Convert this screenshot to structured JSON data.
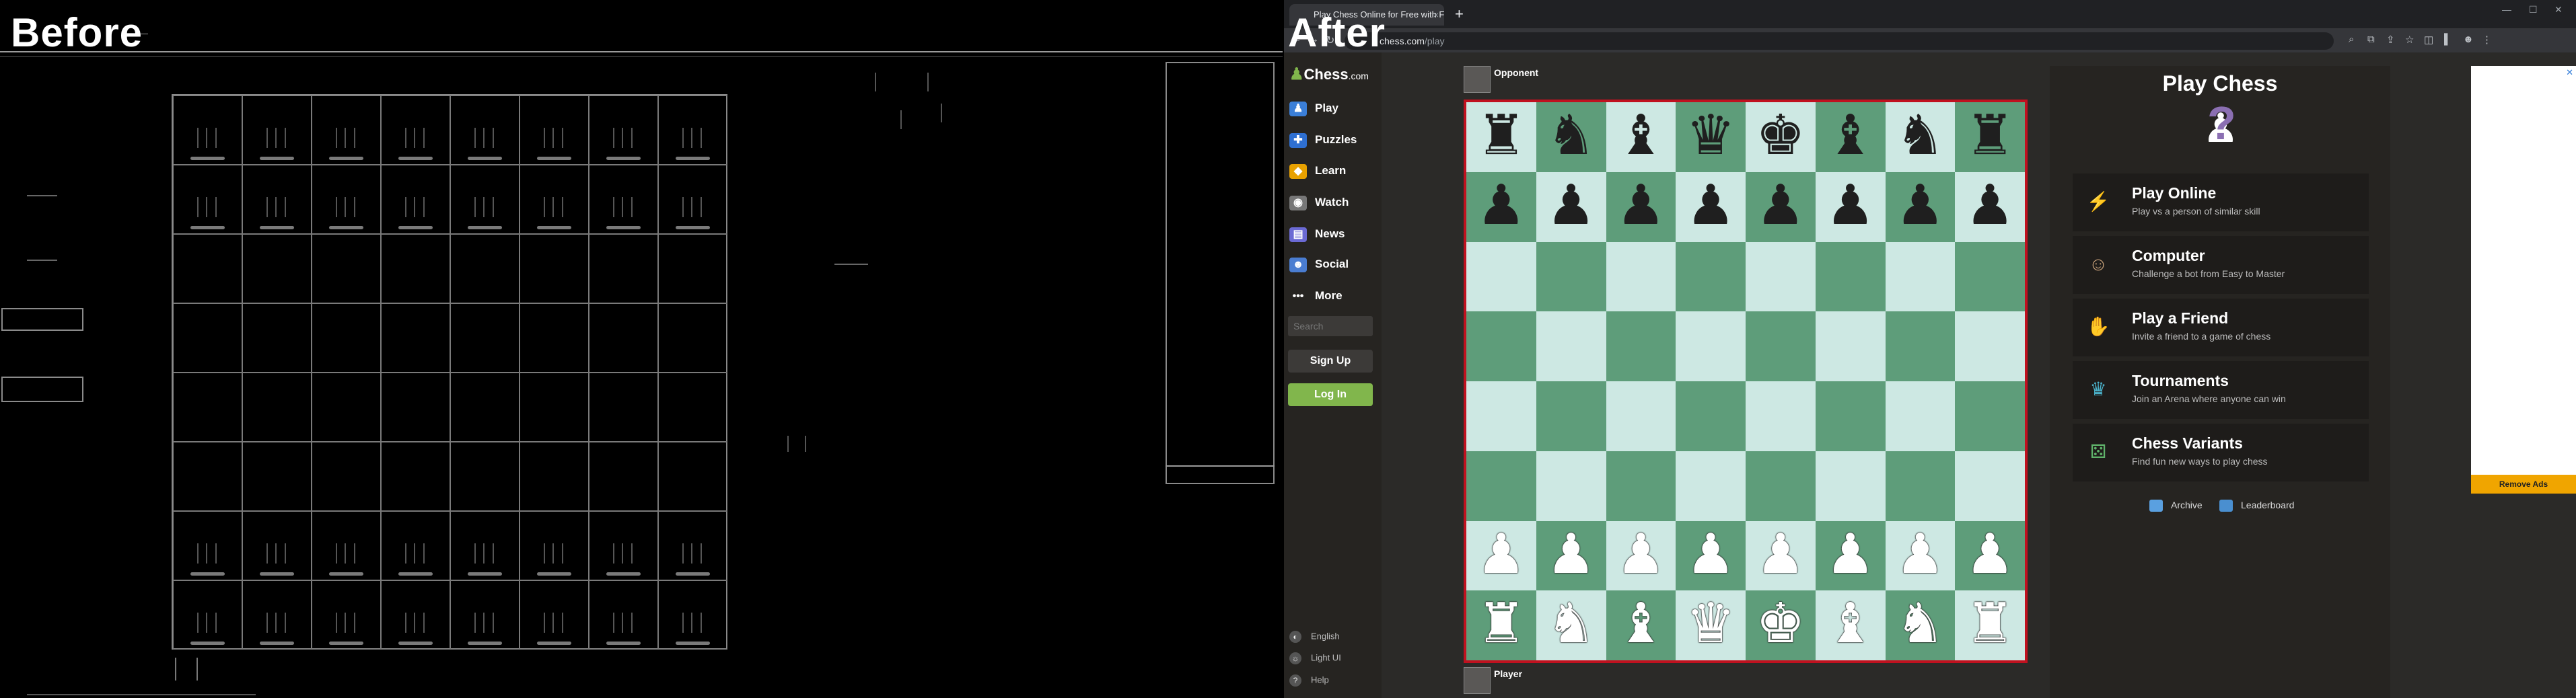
{
  "labels": {
    "before": "Before",
    "after": "After"
  },
  "browser": {
    "tab_title": "Play Chess Online for Free with Friends",
    "tab_close": "×",
    "new_tab": "+",
    "url_host": "chess.com",
    "url_path": "/play",
    "win_min": "—",
    "win_max": "☐",
    "win_close": "✕"
  },
  "sidebar": {
    "logo_text": "Chess",
    "logo_suffix": ".com",
    "items": [
      {
        "label": "Play",
        "icon": "play-icon",
        "color": "#3b7fd8",
        "glyph": "♟"
      },
      {
        "label": "Puzzles",
        "icon": "puzzle-icon",
        "color": "#2e6fd1",
        "glyph": "✚"
      },
      {
        "label": "Learn",
        "icon": "learn-icon",
        "color": "#e8a100",
        "glyph": "◆"
      },
      {
        "label": "Watch",
        "icon": "watch-icon",
        "color": "#777777",
        "glyph": "◉"
      },
      {
        "label": "News",
        "icon": "news-icon",
        "color": "#6b6ad4",
        "glyph": "▤"
      },
      {
        "label": "Social",
        "icon": "social-icon",
        "color": "#4a7dd1",
        "glyph": "☻"
      },
      {
        "label": "More",
        "icon": "more-icon",
        "color": "#262421",
        "glyph": "•••"
      }
    ],
    "search_placeholder": "Search",
    "signup": "Sign Up",
    "login": "Log In",
    "footer": [
      {
        "label": "English",
        "glyph": "◐"
      },
      {
        "label": "Light UI",
        "glyph": "☼"
      },
      {
        "label": "Help",
        "glyph": "?"
      }
    ]
  },
  "board": {
    "opponent": "Opponent",
    "player": "Player",
    "rows": [
      [
        "r",
        "n",
        "b",
        "q",
        "k",
        "b",
        "n",
        "r"
      ],
      [
        "p",
        "p",
        "p",
        "p",
        "p",
        "p",
        "p",
        "p"
      ],
      [
        "",
        "",
        "",
        "",
        "",
        "",
        "",
        ""
      ],
      [
        "",
        "",
        "",
        "",
        "",
        "",
        "",
        ""
      ],
      [
        "",
        "",
        "",
        "",
        "",
        "",
        "",
        ""
      ],
      [
        "",
        "",
        "",
        "",
        "",
        "",
        "",
        ""
      ],
      [
        "P",
        "P",
        "P",
        "P",
        "P",
        "P",
        "P",
        "P"
      ],
      [
        "R",
        "N",
        "B",
        "Q",
        "K",
        "B",
        "N",
        "R"
      ]
    ]
  },
  "play_panel": {
    "title": "Play Chess",
    "options": [
      {
        "title": "Play Online",
        "subtitle": "Play vs a person of similar skill",
        "icon": "lightning-icon",
        "color": "#3a8fe0",
        "glyph": "⚡"
      },
      {
        "title": "Computer",
        "subtitle": "Challenge a bot from Easy to Master",
        "icon": "computer-bot-icon",
        "color": "#c9a27a",
        "glyph": "☺"
      },
      {
        "title": "Play a Friend",
        "subtitle": "Invite a friend to a game of chess",
        "icon": "handshake-icon",
        "color": "#6b8fd4",
        "glyph": "✋"
      },
      {
        "title": "Tournaments",
        "subtitle": "Join an Arena where anyone can win",
        "icon": "trophy-icon",
        "color": "#4ab0c8",
        "glyph": "♛"
      },
      {
        "title": "Chess Variants",
        "subtitle": "Find fun new ways to play chess",
        "icon": "dice-icon",
        "color": "#5fb26a",
        "glyph": "⚄"
      }
    ],
    "archive": "Archive",
    "leaderboard": "Leaderboard"
  },
  "ad": {
    "close": "✕",
    "remove": "Remove Ads"
  }
}
